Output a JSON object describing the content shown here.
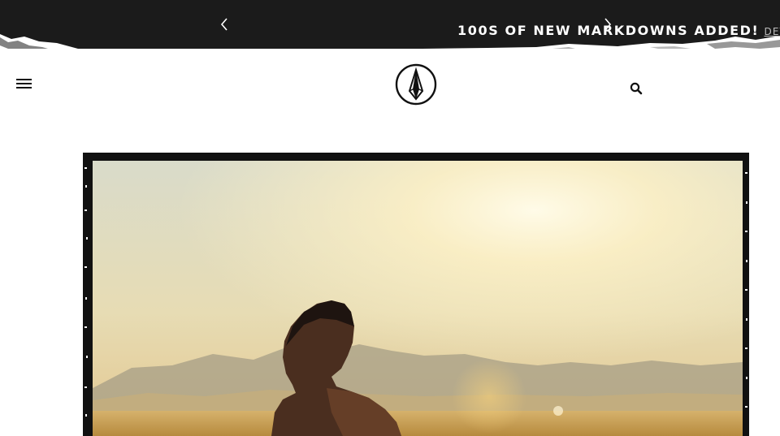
{
  "promo": {
    "message": "100S OF NEW MARKDOWNS ADDED!",
    "link_label": "DETAILS"
  },
  "header": {
    "menu_icon": "hamburger-menu-icon",
    "logo_icon": "volcom-stone-logo",
    "search_icon": "search-icon"
  },
  "colors": {
    "promo_background": "#1b1b1b",
    "promo_text": "#ffffff",
    "page_background": "#ffffff"
  },
  "hero": {
    "image": "surfer-at-sunset-photo"
  }
}
